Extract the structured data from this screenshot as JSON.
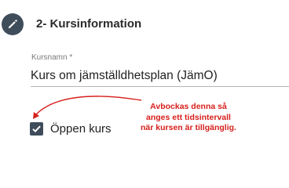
{
  "section": {
    "title": "2- Kursinformation",
    "icon": "pencil-icon"
  },
  "course_name_field": {
    "label": "Kursnamn *",
    "value": "Kurs om jämställdhetsplan (JämO)"
  },
  "open_course_checkbox": {
    "label": "Öppen kurs",
    "checked": true
  },
  "annotation": {
    "text": "Avbockas denna så anges ett tidsintervall när kursen är tillgänglig.",
    "color": "#d6201c"
  },
  "colors": {
    "accent": "#3f4d5b"
  }
}
